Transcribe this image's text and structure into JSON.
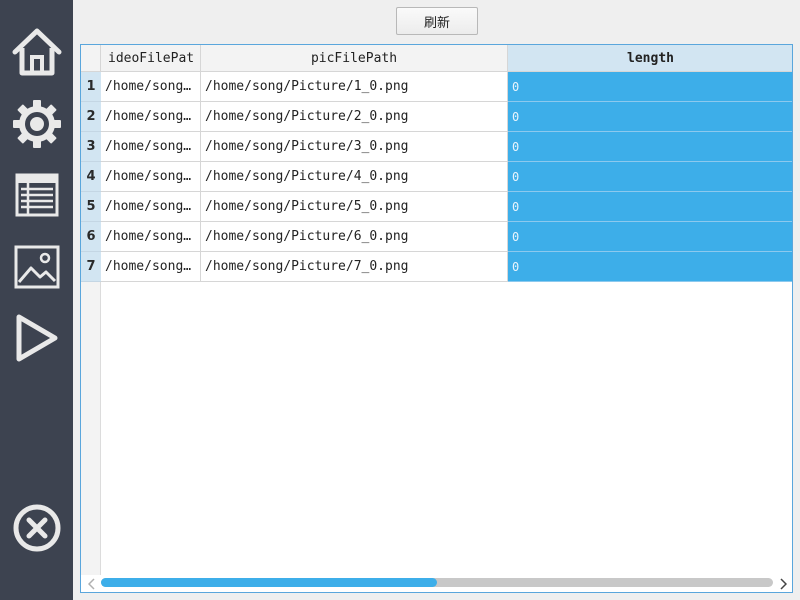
{
  "sidebar": {
    "items": [
      {
        "icon": "home-icon"
      },
      {
        "icon": "gear-icon"
      },
      {
        "icon": "table-icon"
      },
      {
        "icon": "image-icon"
      },
      {
        "icon": "play-icon"
      }
    ],
    "close_icon": "close-icon"
  },
  "toolbar": {
    "refresh_label": "刷新"
  },
  "table": {
    "columns": [
      "ideoFilePat",
      "picFilePath",
      "length"
    ],
    "selected_column": "length",
    "rows": [
      {
        "num": "1",
        "video": "/home/song…",
        "pic": "/home/song/Picture/1_0.png",
        "length": "0"
      },
      {
        "num": "2",
        "video": "/home/song…",
        "pic": "/home/song/Picture/2_0.png",
        "length": "0"
      },
      {
        "num": "3",
        "video": "/home/song…",
        "pic": "/home/song/Picture/3_0.png",
        "length": "0"
      },
      {
        "num": "4",
        "video": "/home/song…",
        "pic": "/home/song/Picture/4_0.png",
        "length": "0"
      },
      {
        "num": "5",
        "video": "/home/song…",
        "pic": "/home/song/Picture/5_0.png",
        "length": "0"
      },
      {
        "num": "6",
        "video": "/home/song…",
        "pic": "/home/song/Picture/6_0.png",
        "length": "0"
      },
      {
        "num": "7",
        "video": "/home/song…",
        "pic": "/home/song/Picture/7_0.png",
        "length": "0"
      }
    ]
  },
  "scrollbar": {
    "position_fraction": 0.5
  },
  "colors": {
    "sidebar": "#3d4350",
    "accent": "#3daee9",
    "header_selected": "#d2e5f2"
  }
}
